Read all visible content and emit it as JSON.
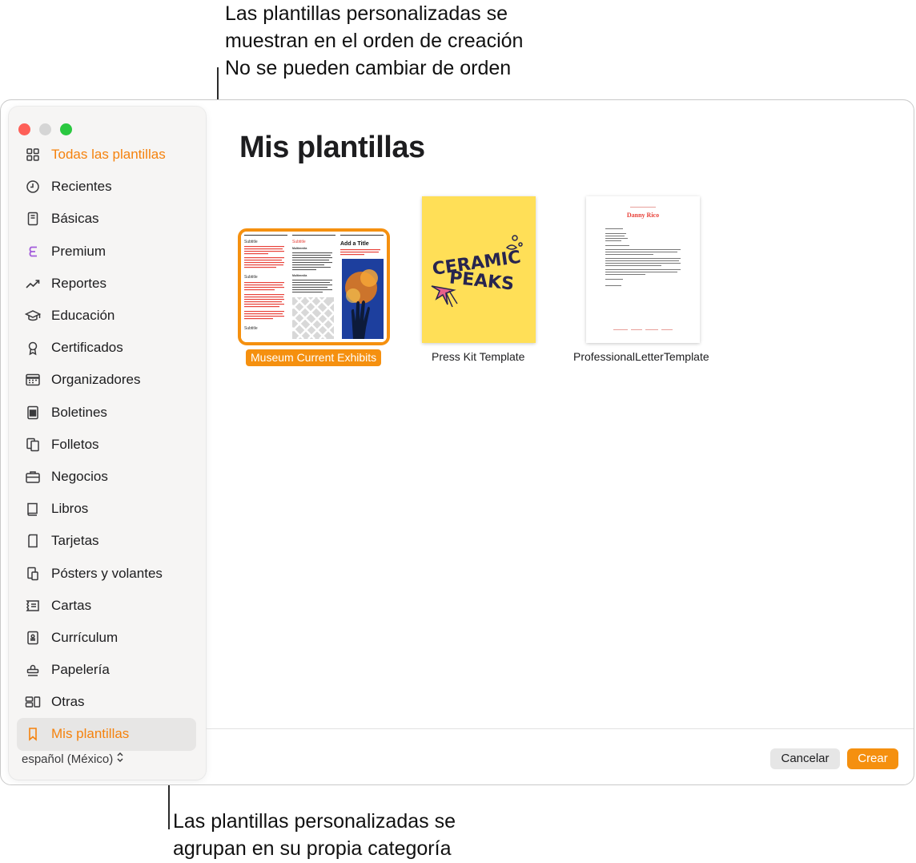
{
  "callouts": {
    "top": [
      "Las plantillas personalizadas se",
      "muestran en el orden de creación",
      "No se pueden cambiar de orden"
    ],
    "bottom": [
      "Las plantillas personalizadas se",
      "agrupan en su propia categoría"
    ]
  },
  "sidebar": {
    "items": [
      {
        "label": "Todas las plantillas",
        "icon": "grid-icon"
      },
      {
        "label": "Recientes",
        "icon": "clock-icon"
      },
      {
        "label": "Básicas",
        "icon": "document-icon"
      },
      {
        "label": "Premium",
        "icon": "premium-icon"
      },
      {
        "label": "Reportes",
        "icon": "chart-trend-icon"
      },
      {
        "label": "Educación",
        "icon": "graduation-cap-icon"
      },
      {
        "label": "Certificados",
        "icon": "ribbon-icon"
      },
      {
        "label": "Organizadores",
        "icon": "calendar-icon"
      },
      {
        "label": "Boletines",
        "icon": "newsletter-icon"
      },
      {
        "label": "Folletos",
        "icon": "brochure-icon"
      },
      {
        "label": "Negocios",
        "icon": "briefcase-icon"
      },
      {
        "label": "Libros",
        "icon": "book-icon"
      },
      {
        "label": "Tarjetas",
        "icon": "card-icon"
      },
      {
        "label": "Pósters y volantes",
        "icon": "poster-icon"
      },
      {
        "label": "Cartas",
        "icon": "letter-icon"
      },
      {
        "label": "Currículum",
        "icon": "resume-icon"
      },
      {
        "label": "Papelería",
        "icon": "stamp-icon"
      },
      {
        "label": "Otras",
        "icon": "shapes-icon"
      },
      {
        "label": "Mis plantillas",
        "icon": "bookmark-icon"
      }
    ],
    "language": "español (México)"
  },
  "main": {
    "title": "Mis plantillas",
    "templates": [
      {
        "name": "Museum Current Exhibits",
        "thumb": {
          "subtitle_1": "Subtitle",
          "subtitle_2": "Subtitle",
          "subtitle_3": "Subtitle",
          "heading": "Add a Title",
          "body_head_1": "Multimedia",
          "body_head_2": "Multimedia"
        }
      },
      {
        "name": "Press Kit Template",
        "thumb": {
          "logo_line_1": "CERAMIC",
          "logo_line_2": "PEAKS"
        }
      },
      {
        "name": "ProfessionalLetterTemplate",
        "thumb": {
          "signature_name": "Danny Rico"
        }
      }
    ]
  },
  "footer": {
    "cancel_label": "Cancelar",
    "create_label": "Crear"
  },
  "colors": {
    "accent": "#f5900f",
    "selected_text": "#f5820d",
    "press_kit_bg": "#ffdf57",
    "letter_accent": "#e8423a"
  }
}
